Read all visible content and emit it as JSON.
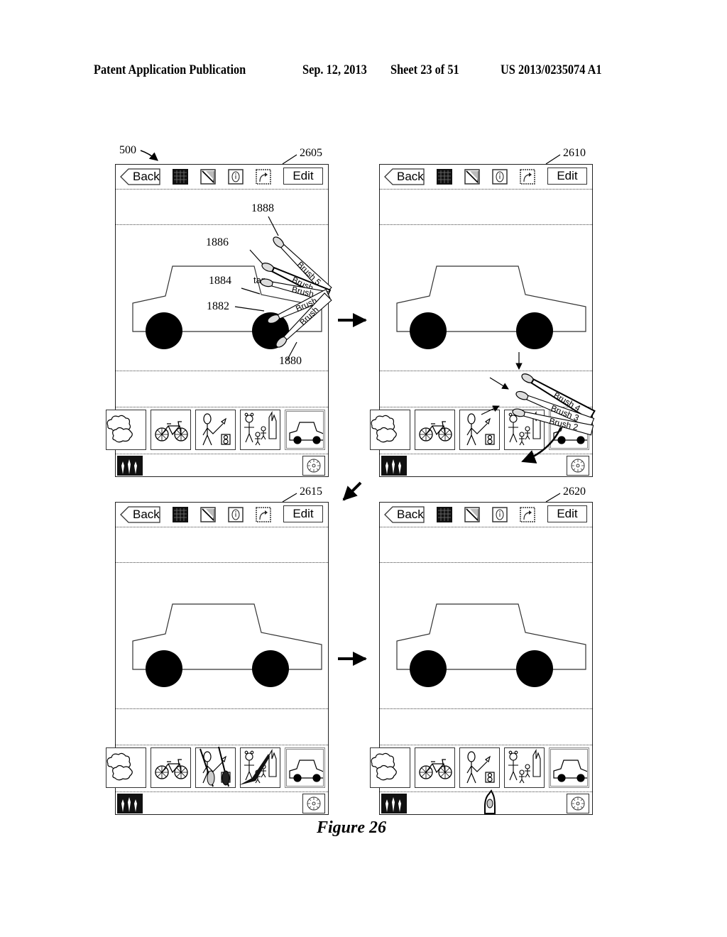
{
  "header": {
    "left": "Patent Application Publication",
    "date": "Sep. 12, 2013",
    "sheet": "Sheet 23 of 51",
    "number": "US 2013/0235074 A1"
  },
  "figure_title": "Figure 26",
  "device_ref": "500",
  "ui": {
    "back_label": "Back",
    "edit_label": "Edit",
    "tools": [
      "grid-pattern-icon",
      "fill-triangle-icon",
      "info-icon",
      "redo-arrow-icon"
    ],
    "thumbnails": [
      "clouds",
      "bicycle",
      "stick-figure-with-flower",
      "family-with-building",
      "car"
    ],
    "selected_thumbnail": "car",
    "brushes_button_icon": "brushes-icon",
    "settings_button_icon": "settings-wheel-icon"
  },
  "panels": [
    {
      "id": "2605",
      "annotations": {
        "brush_refs": [
          "1888",
          "1886",
          "1884",
          "1882",
          "1880"
        ],
        "tap_label": "tap",
        "brush_labels": [
          "Brush 5",
          "Brush",
          "Brush",
          "Brush",
          "Brush"
        ]
      }
    },
    {
      "id": "2610",
      "annotations": {
        "brush_labels": [
          "Brush 4",
          "Brush 3",
          "Brush 2"
        ]
      }
    },
    {
      "id": "2615"
    },
    {
      "id": "2620"
    }
  ]
}
